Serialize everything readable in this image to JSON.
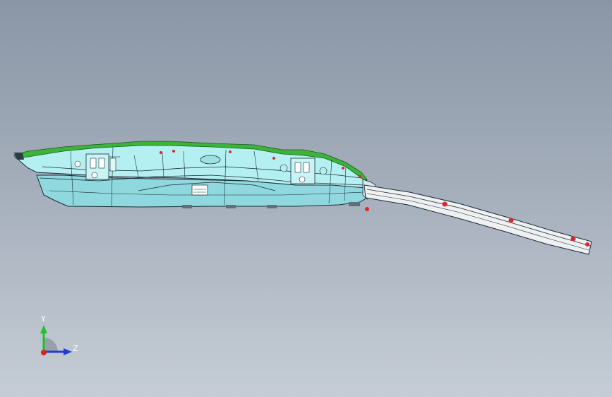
{
  "viewport": {
    "part_colors": {
      "body": "#a8ecef",
      "body_shadow": "#7cc8d0",
      "trim_green": "#3cb43a",
      "rail": "#eef0f2",
      "marker_red": "#e0262a",
      "edge_line": "#1c2a33"
    }
  },
  "triad": {
    "y_label": "Y",
    "z_label": "Z",
    "x_color": "#e02020",
    "y_color": "#22c02a",
    "z_color": "#1d3fd0"
  }
}
